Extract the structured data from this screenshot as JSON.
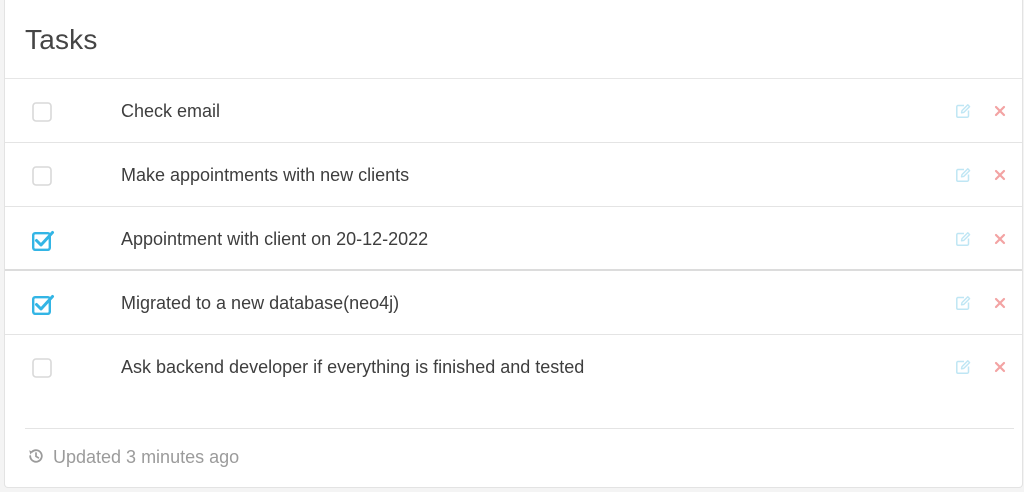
{
  "card": {
    "title": "Tasks",
    "footer_text": "Updated 3 minutes ago"
  },
  "tasks": [
    {
      "label": "Check email",
      "checked": false
    },
    {
      "label": "Make appointments with new clients",
      "checked": false
    },
    {
      "label": "Appointment with client on 20-12-2022",
      "checked": true
    },
    {
      "label": "Migrated to a new database(neo4j)",
      "checked": true
    },
    {
      "label": "Ask backend developer if everything is finished and tested",
      "checked": false
    }
  ],
  "icons": {
    "checkbox_checked": "checkbox-checked-icon",
    "checkbox_unchecked": "checkbox-unchecked-icon",
    "edit": "edit-icon",
    "delete": "delete-icon",
    "history": "history-icon"
  },
  "colors": {
    "accent": "#33b5e5",
    "edit": "#bfe6f4",
    "delete": "#f3a3a3",
    "text": "#3e3e3e",
    "muted": "#9b9b9b"
  }
}
